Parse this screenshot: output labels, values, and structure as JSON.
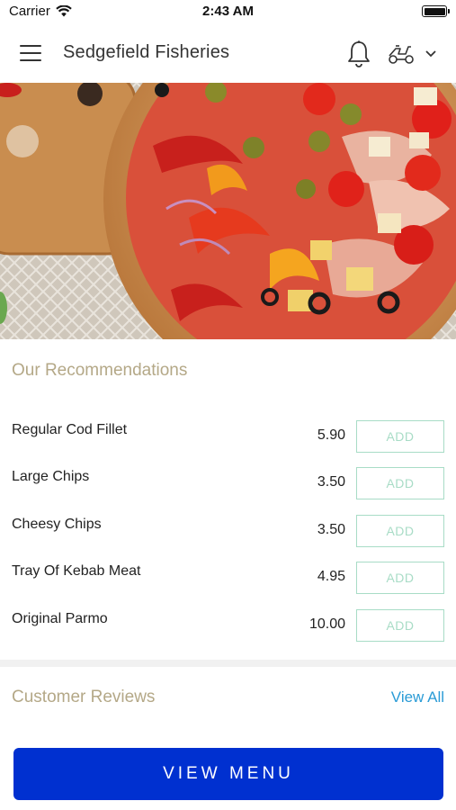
{
  "status_bar": {
    "carrier": "Carrier",
    "time": "2:43 AM"
  },
  "header": {
    "title": "Sedgefield Fisheries",
    "icons": [
      "hamburger-menu-icon",
      "bell-icon",
      "scooter-icon",
      "chevron-down-icon"
    ]
  },
  "recommendations": {
    "title": "Our Recommendations",
    "items": [
      {
        "name": "Regular Cod Fillet",
        "price": "5.90",
        "button": "ADD"
      },
      {
        "name": "Large Chips",
        "price": "3.50",
        "button": "ADD"
      },
      {
        "name": "Cheesy Chips",
        "price": "3.50",
        "button": "ADD"
      },
      {
        "name": "Tray Of Kebab Meat",
        "price": "4.95",
        "button": "ADD"
      },
      {
        "name": "Original Parmo",
        "price": "10.00",
        "button": "ADD"
      }
    ]
  },
  "reviews": {
    "title": "Customer Reviews",
    "view_all": "View All"
  },
  "cta": {
    "label": "VIEW MENU"
  },
  "colors": {
    "section_title": "#b4a887",
    "add_button": "#a8dcc6",
    "link": "#2a9bd6",
    "primary_button": "#0030d0"
  }
}
